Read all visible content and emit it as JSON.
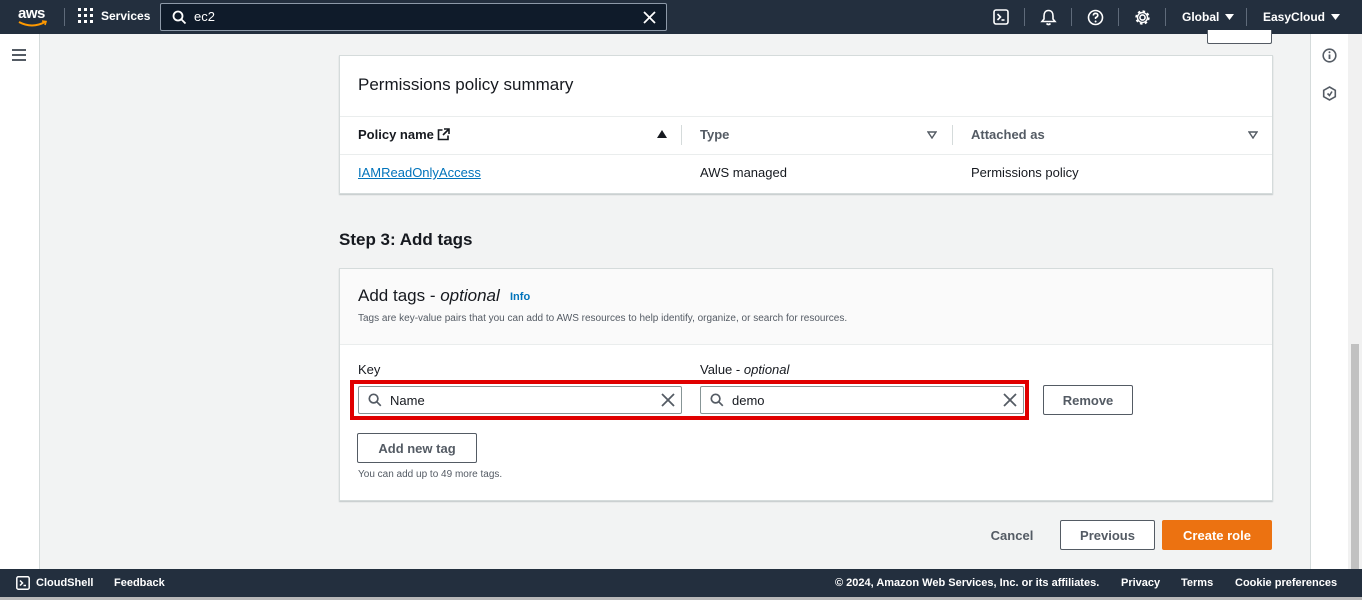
{
  "topnav": {
    "logo_text": "aws",
    "services_label": "Services",
    "search_value": "ec2",
    "region_label": "Global",
    "account_label": "EasyCloud",
    "icons": [
      "cloudshell-icon",
      "notifications-icon",
      "help-icon",
      "settings-icon"
    ]
  },
  "permissions": {
    "title": "Permissions policy summary",
    "columns": [
      "Policy name",
      "Type",
      "Attached as"
    ],
    "rows": [
      {
        "policy_name": "IAMReadOnlyAccess",
        "type": "AWS managed",
        "attached_as": "Permissions policy"
      }
    ]
  },
  "step3": {
    "title": "Step 3: Add tags"
  },
  "tags": {
    "title": "Add tags",
    "title_suffix": "optional",
    "info_link": "Info",
    "description": "Tags are key-value pairs that you can add to AWS resources to help identify, organize, or search for resources.",
    "key_label": "Key",
    "value_label": "Value",
    "value_label_suffix": "optional",
    "key_value": "Name",
    "value_value": "demo",
    "remove_label": "Remove",
    "add_new_label": "Add new tag",
    "limit_note": "You can add up to 49 more tags."
  },
  "actions": {
    "cancel": "Cancel",
    "previous": "Previous",
    "create": "Create role"
  },
  "footer": {
    "cloudshell": "CloudShell",
    "feedback": "Feedback",
    "copyright": "© 2024, Amazon Web Services, Inc. or its affiliates.",
    "privacy": "Privacy",
    "terms": "Terms",
    "cookies": "Cookie preferences"
  },
  "colors": {
    "nav_bg": "#232f3e",
    "primary": "#ec7211",
    "link": "#0073bb",
    "highlight": "#e00000"
  }
}
